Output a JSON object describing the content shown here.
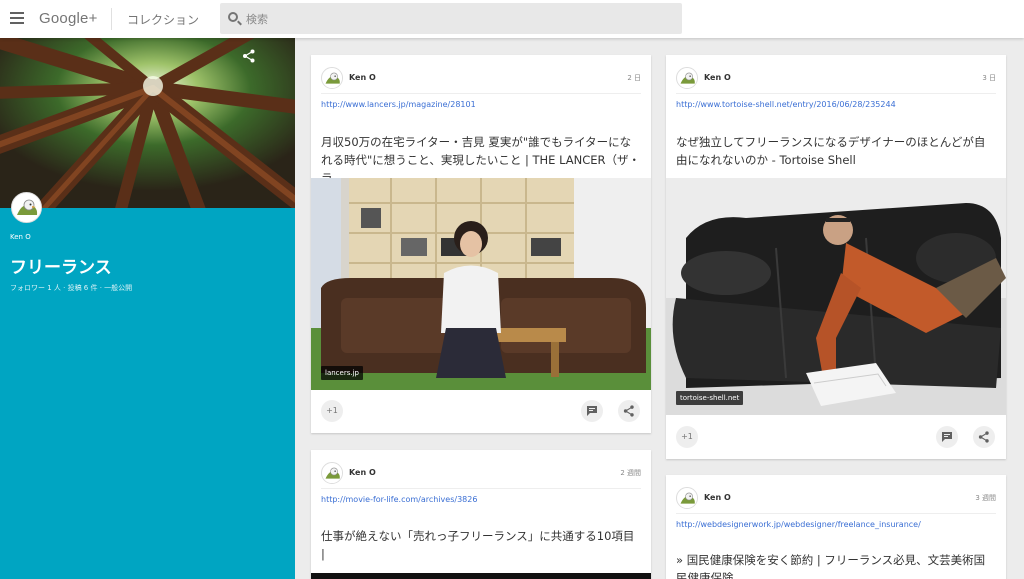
{
  "topbar": {
    "logo": "Google+",
    "section": "コレクション",
    "search_placeholder": "検索"
  },
  "collection": {
    "owner": "Ken O",
    "title": "フリーランス",
    "meta": "フォロワー 1 人 · 投稿 6 件 · 一般公開"
  },
  "posts": [
    {
      "author": "Ken O",
      "time": "2 日",
      "url": "http://www.lancers.jp/magazine/28101",
      "title": "月収50万の在宅ライター・吉見 夏実が\"誰でもライターになれる時代\"に想うこと、実現したいこと | THE LANCER（ザ・ラ",
      "image_label": "lancers.jp",
      "plus_label": "+1"
    },
    {
      "author": "Ken O",
      "time": "2 週間",
      "url": "http://movie-for-life.com/archives/3826",
      "title": "仕事が絶えない「売れっ子フリーランス」に共通する10項目 |"
    },
    {
      "author": "Ken O",
      "time": "3 日",
      "url": "http://www.tortoise-shell.net/entry/2016/06/28/235244",
      "title": "なぜ独立してフリーランスになるデザイナーのほとんどが自由になれないのか - Tortoise Shell",
      "image_label": "tortoise-shell.net",
      "plus_label": "+1"
    },
    {
      "author": "Ken O",
      "time": "3 週間",
      "url": "http://webdesignerwork.jp/webdesigner/freelance_insurance/",
      "title": "» 国民健康保険を安く節約 | フリーランス必見、文芸美術国民健康保険"
    }
  ],
  "colors": {
    "accent": "#00a5c2",
    "link": "#3b6fd4"
  }
}
